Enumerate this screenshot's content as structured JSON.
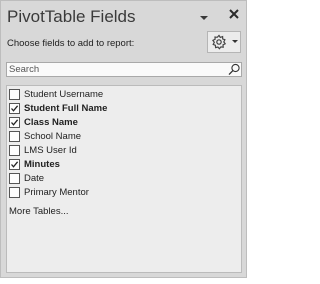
{
  "pane": {
    "title": "PivotTable Fields",
    "choose_label": "Choose fields to add to report:",
    "search_placeholder": "Search",
    "more_tables": "More Tables...",
    "fields": [
      {
        "label": "Student Username",
        "checked": false
      },
      {
        "label": "Student Full Name",
        "checked": true
      },
      {
        "label": "Class Name",
        "checked": true
      },
      {
        "label": "School Name",
        "checked": false
      },
      {
        "label": "LMS User Id",
        "checked": false
      },
      {
        "label": "Minutes",
        "checked": true
      },
      {
        "label": "Date",
        "checked": false
      },
      {
        "label": "Primary Mentor",
        "checked": false
      }
    ]
  },
  "icons": {
    "task_pane_options": "chevron-down-icon",
    "close": "close-icon",
    "tools": "gear-icon",
    "tools_dropdown": "caret-down-icon",
    "search": "search-icon",
    "checkbox_checked": "check-icon"
  },
  "colors": {
    "pane_background": "#d8d8d8",
    "list_background": "#ededed",
    "text": "#222222"
  }
}
